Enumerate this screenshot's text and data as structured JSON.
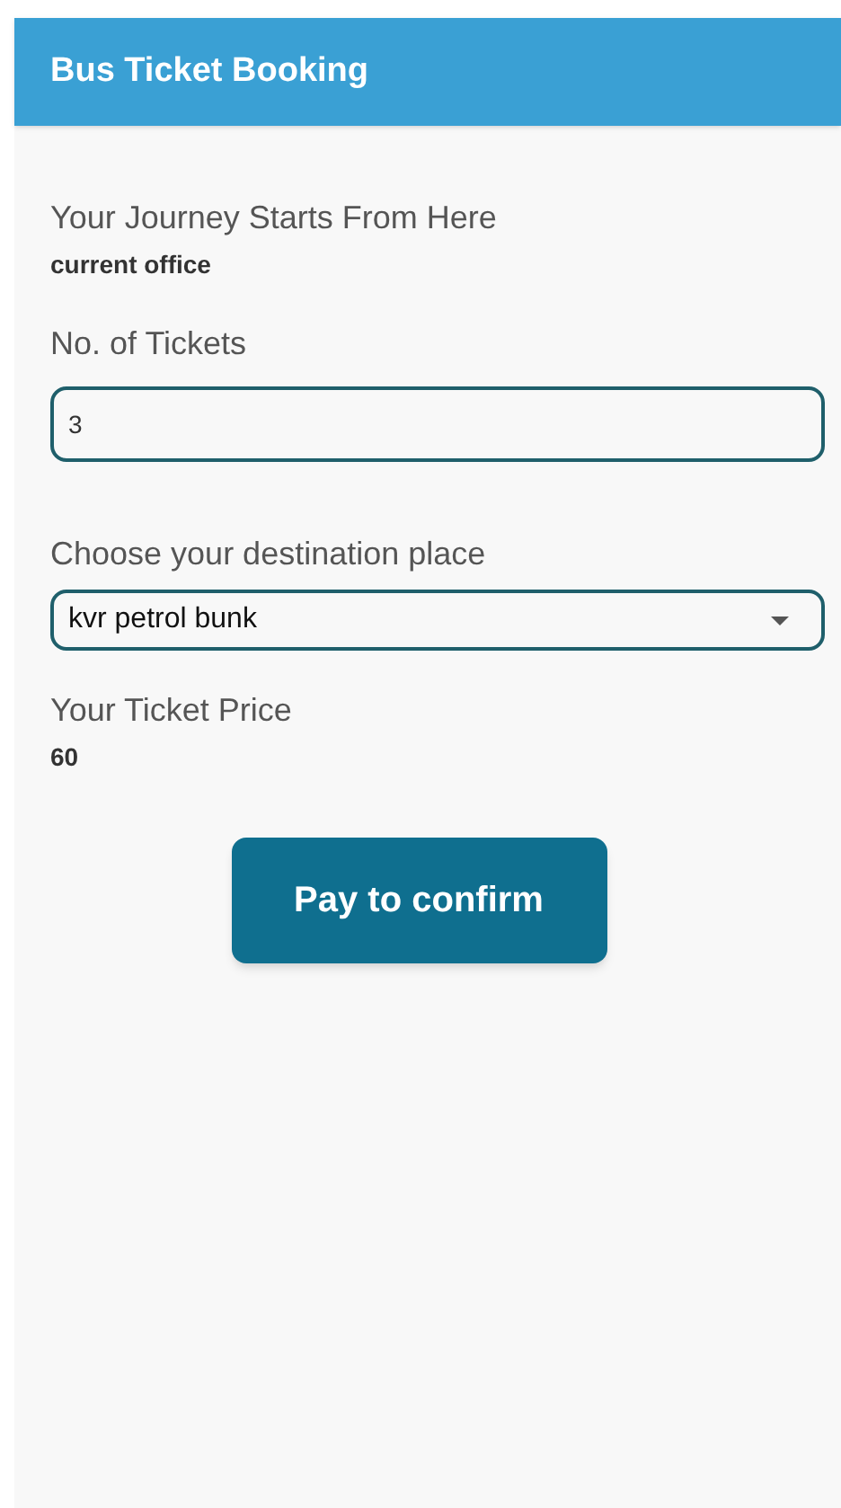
{
  "app_bar": {
    "title": "Bus Ticket Booking"
  },
  "origin": {
    "label": "Your Journey Starts From Here",
    "value": "current office"
  },
  "tickets": {
    "label": "No. of Tickets",
    "value": "3"
  },
  "destination": {
    "label": "Choose your destination place",
    "value": "kvr petrol bunk"
  },
  "price": {
    "label": "Your Ticket Price",
    "value": "60"
  },
  "button": "Pay to confirm"
}
